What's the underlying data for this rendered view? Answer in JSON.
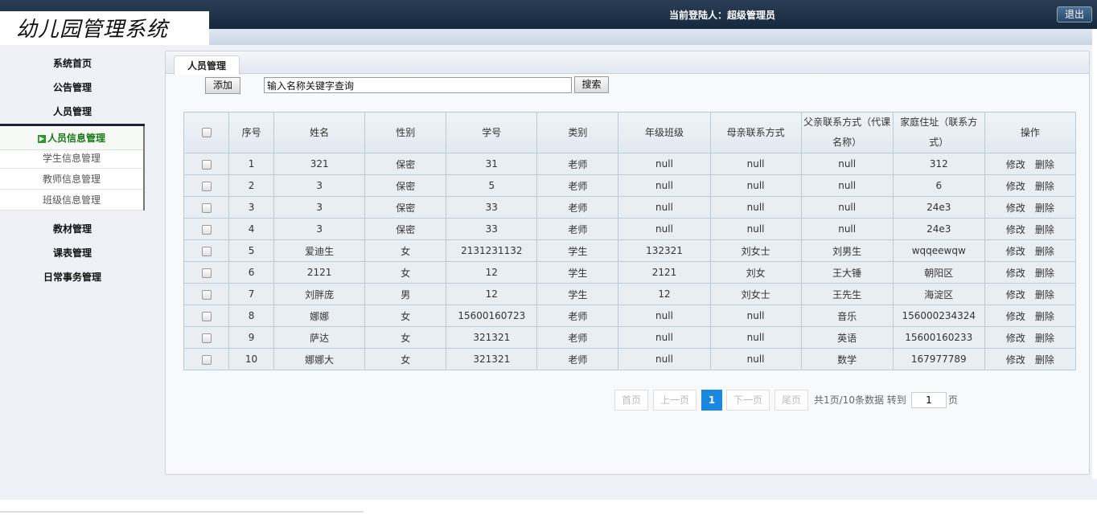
{
  "header": {
    "logo_text": "幼儿园管理系统",
    "login_label": "当前登陆人：",
    "login_user": "超级管理员",
    "logout_label": "退出"
  },
  "sidebar": {
    "menu": [
      "系统首页",
      "公告管理",
      "人员管理"
    ],
    "active_sub": "人员信息管理",
    "sub_items": [
      "学生信息管理",
      "教师信息管理",
      "班级信息管理"
    ],
    "menu_after": [
      "教材管理",
      "课表管理",
      "日常事务管理"
    ]
  },
  "panel": {
    "tab_label": "人员管理",
    "add_label": "添加",
    "search_value": "输入名称关键字查询",
    "search_label": "搜索"
  },
  "table": {
    "headers": [
      "序号",
      "姓名",
      "性别",
      "学号",
      "类别",
      "年级班级",
      "母亲联系方式",
      "父亲联系方式（代课名称）",
      "家庭住址（联系方式）",
      "操作"
    ],
    "rows": [
      [
        "1",
        "321",
        "保密",
        "31",
        "老师",
        "null",
        "null",
        "null",
        "312"
      ],
      [
        "2",
        "3",
        "保密",
        "5",
        "老师",
        "null",
        "null",
        "null",
        "6"
      ],
      [
        "3",
        "3",
        "保密",
        "33",
        "老师",
        "null",
        "null",
        "null",
        "24e3"
      ],
      [
        "4",
        "3",
        "保密",
        "33",
        "老师",
        "null",
        "null",
        "null",
        "24e3"
      ],
      [
        "5",
        "爱迪生",
        "女",
        "2131231132",
        "学生",
        "132321",
        "刘女士",
        "刘男生",
        "wqqeewqw"
      ],
      [
        "6",
        "2121",
        "女",
        "12",
        "学生",
        "2121",
        "刘女",
        "王大锤",
        "朝阳区"
      ],
      [
        "7",
        "刘胖庞",
        "男",
        "12",
        "学生",
        "12",
        "刘女士",
        "王先生",
        "海淀区"
      ],
      [
        "8",
        "娜娜",
        "女",
        "15600160723",
        "老师",
        "null",
        "null",
        "音乐",
        "156000234324"
      ],
      [
        "9",
        "萨达",
        "女",
        "321321",
        "老师",
        "null",
        "null",
        "英语",
        "15600160233"
      ],
      [
        "10",
        "娜娜大",
        "女",
        "321321",
        "老师",
        "null",
        "null",
        "数学",
        "167977789"
      ]
    ],
    "edit_label": "修改",
    "delete_label": "删除"
  },
  "pagination": {
    "first": "首页",
    "prev": "上一页",
    "current": "1",
    "next": "下一页",
    "last": "尾页",
    "info": "共1页/10条数据 转到",
    "goto_value": "1",
    "unit": "页"
  }
}
